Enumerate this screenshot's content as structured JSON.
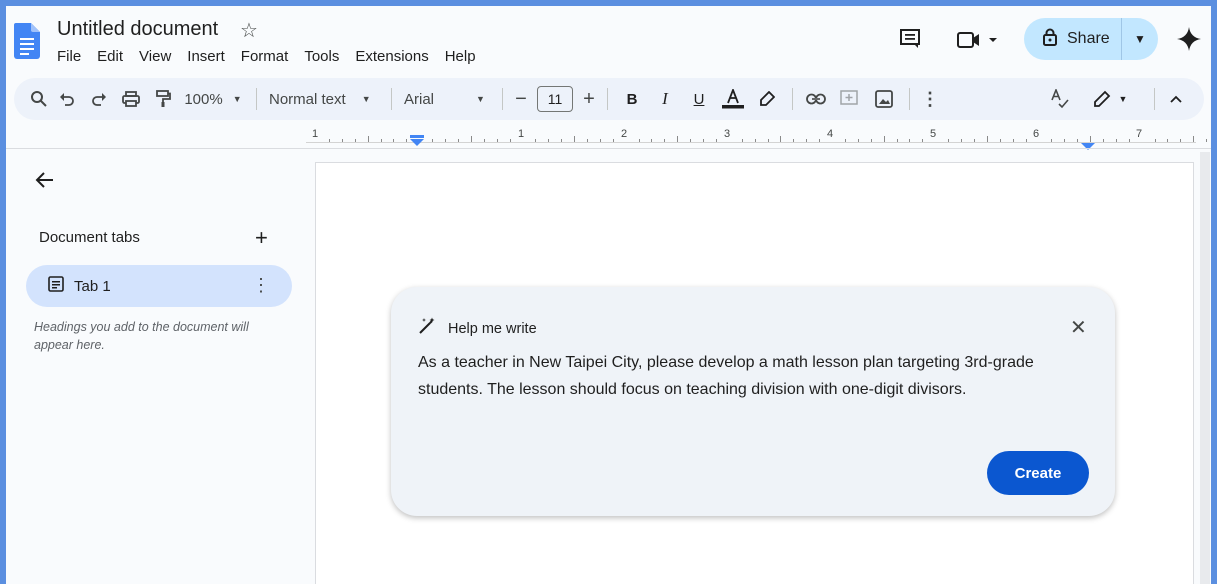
{
  "header": {
    "title": "Untitled document",
    "menu": [
      "File",
      "Edit",
      "View",
      "Insert",
      "Format",
      "Tools",
      "Extensions",
      "Help"
    ],
    "share_label": "Share"
  },
  "toolbar": {
    "zoom": "100%",
    "style": "Normal text",
    "font": "Arial",
    "font_size": "11"
  },
  "ruler": {
    "numbers": [
      "1",
      "1",
      "2",
      "3",
      "4",
      "5",
      "6",
      "7"
    ]
  },
  "sidebar": {
    "title": "Document tabs",
    "tabs": [
      {
        "label": "Tab 1"
      }
    ],
    "hint": "Headings you add to the document will appear here."
  },
  "help_me_write": {
    "title": "Help me write",
    "prompt": "As a teacher in New Taipei City, please develop a math lesson plan targeting 3rd-grade students. The lesson should focus on teaching division with one-digit divisors.",
    "create_label": "Create"
  },
  "colors": {
    "accent": "#0b57d0",
    "share_bg": "#c2e7ff",
    "toolbar_bg": "#edf2fa",
    "tab_active_bg": "#d3e3fd"
  }
}
